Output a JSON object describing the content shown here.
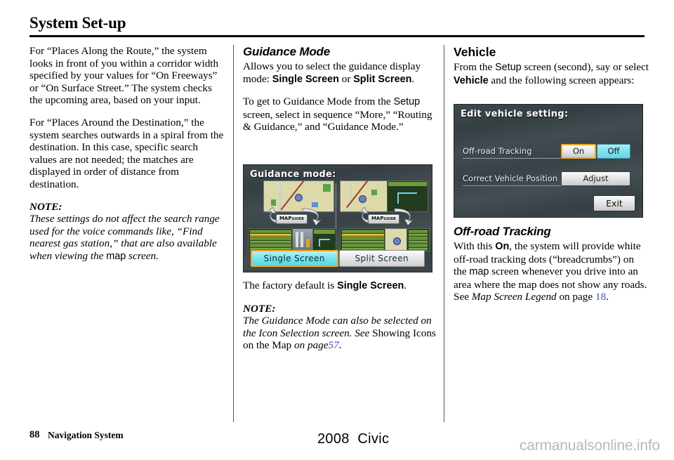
{
  "page": {
    "title": "System Set-up"
  },
  "col1": {
    "para1": "For “Places Along the Route,” the system looks in front of you within a corridor width specified by your values for “On Freeways” or “On Surface Street.” The system checks the upcoming area, based on your input.",
    "para2": "For “Places Around the Destination,” the system searches outwards in a spiral from the destination. In this case, specific search values are not needed; the matches are displayed in order of distance from destination.",
    "note_label": "NOTE:",
    "note_part1": "These settings do not affect the search range used for the voice commands like, “Find nearest gas station,” that are also available when viewing the ",
    "note_map_word": "map",
    "note_part2": " screen."
  },
  "col2": {
    "heading": "Guidance Mode",
    "para1_a": "Allows you to select the guidance display mode: ",
    "para1_single": "Single Screen",
    "para1_or": " or ",
    "para1_split": "Split Screen",
    "para1_end": ".",
    "para2_a": "To get to Guidance Mode from the ",
    "para2_setup": "Setup",
    "para2_b": " screen, select in sequence “More,” “Routing & Guidance,” and “Guidance Mode.”",
    "factory_a": "The factory default is ",
    "factory_single": "Single Screen",
    "factory_end": ".",
    "note_label": "NOTE:",
    "note_line1": "The Guidance Mode can also be selected on the Icon Selection screen.",
    "note_see": "See",
    "note_ref_title": " Showing Icons on the Map ",
    "note_on": "on",
    "note_page_label": "page",
    "note_page_num": "57",
    "note_period": "."
  },
  "col3": {
    "heading": "Vehicle",
    "para1_a": "From the ",
    "para1_setup": "Setup",
    "para1_b": " screen (second), say or select ",
    "para1_vehicle": "Vehicle",
    "para1_c": " and the following screen appears:",
    "subheading": "Off-road Tracking",
    "para2_a": "With this ",
    "para2_on": "On",
    "para2_b": ", the system will provide white off-road tracking dots (“breadcrumbs”) on the ",
    "para2_map": "map",
    "para2_c": " screen whenever you drive into an area where the map does not show any roads.",
    "see_label": "See ",
    "see_ref": "Map Screen Legend",
    "see_on_page": " on page ",
    "see_page_num": "18",
    "see_period": "."
  },
  "guidance_screen": {
    "title": "Guidance mode:",
    "mapguide_label": "MAP",
    "mapguide_sub": "GUIDE",
    "button_single": "Single Screen",
    "button_split": "Split Screen",
    "selected_button": "Single Screen",
    "highlight_color": "#f0a81e",
    "selected_fill_color": "#79e4ec"
  },
  "vehicle_screen": {
    "title": "Edit vehicle setting:",
    "rows": [
      {
        "label": "Off-road Tracking",
        "buttons": [
          "On",
          "Off"
        ],
        "highlighted": "On",
        "active": "Off"
      },
      {
        "label": "Correct Vehicle Position",
        "buttons": [
          "Adjust"
        ]
      }
    ],
    "exit_label": "Exit",
    "highlight_color": "#f0a81e",
    "active_fill_color": "#7fe1ef"
  },
  "footer": {
    "page_number": "88",
    "section": "Navigation System",
    "model_year": "2008",
    "model_name": "Civic",
    "watermark": "carmanualsonline.info"
  }
}
